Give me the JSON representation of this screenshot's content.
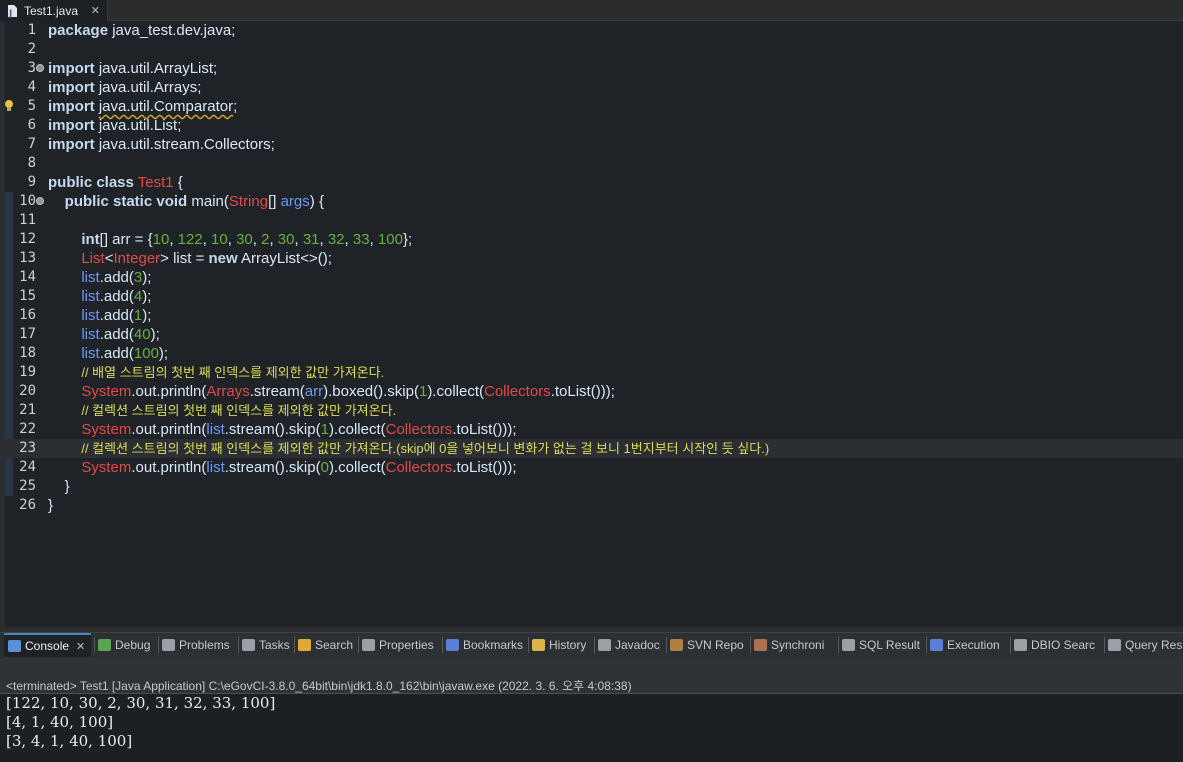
{
  "editor_tab": {
    "title": "Test1.java",
    "icon": "java-file-icon",
    "close_icon": "close-icon"
  },
  "colors": {
    "keyword": "#cc6c1d",
    "type": "#e04b49",
    "field": "#6b9bf4",
    "number": "#6aaf40",
    "comment": "#dddd55",
    "text": "#d9e8f7",
    "editor_bg": "#1f2327"
  },
  "code_lines": [
    {
      "n": "1",
      "tokens": [
        {
          "t": "package",
          "c": "kw2"
        },
        {
          "t": " java_test.dev.java;",
          "c": "plain"
        }
      ]
    },
    {
      "n": "2",
      "tokens": []
    },
    {
      "n": "3",
      "fold": true,
      "tokens": [
        {
          "t": "import",
          "c": "kw2"
        },
        {
          "t": " java.util.ArrayList;",
          "c": "plain"
        }
      ]
    },
    {
      "n": "4",
      "tokens": [
        {
          "t": "import",
          "c": "kw2"
        },
        {
          "t": " java.util.Arrays;",
          "c": "plain"
        }
      ]
    },
    {
      "n": "5",
      "bulb": true,
      "tokens": [
        {
          "t": "import",
          "c": "kw2"
        },
        {
          "t": " ",
          "c": "plain"
        },
        {
          "t": "java.util.Comparator",
          "c": "plain warn"
        },
        {
          "t": ";",
          "c": "plain"
        }
      ]
    },
    {
      "n": "6",
      "tokens": [
        {
          "t": "import",
          "c": "kw2"
        },
        {
          "t": " java.util.List;",
          "c": "plain"
        }
      ]
    },
    {
      "n": "7",
      "tokens": [
        {
          "t": "import",
          "c": "kw2"
        },
        {
          "t": " java.util.stream.Collectors;",
          "c": "plain"
        }
      ]
    },
    {
      "n": "8",
      "tokens": []
    },
    {
      "n": "9",
      "tokens": [
        {
          "t": "public class",
          "c": "kw2"
        },
        {
          "t": " ",
          "c": "plain"
        },
        {
          "t": "Test1",
          "c": "ty"
        },
        {
          "t": " {",
          "c": "plain"
        }
      ]
    },
    {
      "n": "10",
      "fold": true,
      "tokens": [
        {
          "t": "    ",
          "c": "plain"
        },
        {
          "t": "public static void",
          "c": "kw2"
        },
        {
          "t": " main(",
          "c": "plain"
        },
        {
          "t": "String",
          "c": "ty"
        },
        {
          "t": "[] ",
          "c": "plain"
        },
        {
          "t": "args",
          "c": "fld"
        },
        {
          "t": ") {",
          "c": "plain"
        }
      ]
    },
    {
      "n": "11",
      "tokens": []
    },
    {
      "n": "12",
      "tokens": [
        {
          "t": "        ",
          "c": "plain"
        },
        {
          "t": "int",
          "c": "kw2"
        },
        {
          "t": "[] arr = {",
          "c": "plain"
        },
        {
          "t": "10",
          "c": "num"
        },
        {
          "t": ", ",
          "c": "plain"
        },
        {
          "t": "122",
          "c": "num"
        },
        {
          "t": ", ",
          "c": "plain"
        },
        {
          "t": "10",
          "c": "num"
        },
        {
          "t": ", ",
          "c": "plain"
        },
        {
          "t": "30",
          "c": "num"
        },
        {
          "t": ", ",
          "c": "plain"
        },
        {
          "t": "2",
          "c": "num"
        },
        {
          "t": ", ",
          "c": "plain"
        },
        {
          "t": "30",
          "c": "num"
        },
        {
          "t": ", ",
          "c": "plain"
        },
        {
          "t": "31",
          "c": "num"
        },
        {
          "t": ", ",
          "c": "plain"
        },
        {
          "t": "32",
          "c": "num"
        },
        {
          "t": ", ",
          "c": "plain"
        },
        {
          "t": "33",
          "c": "num"
        },
        {
          "t": ", ",
          "c": "plain"
        },
        {
          "t": "100",
          "c": "num"
        },
        {
          "t": "};",
          "c": "plain"
        }
      ]
    },
    {
      "n": "13",
      "tokens": [
        {
          "t": "        ",
          "c": "plain"
        },
        {
          "t": "List",
          "c": "ty"
        },
        {
          "t": "<",
          "c": "plain"
        },
        {
          "t": "Integer",
          "c": "ty"
        },
        {
          "t": "> list = ",
          "c": "plain"
        },
        {
          "t": "new",
          "c": "kw2"
        },
        {
          "t": " ArrayList<>();",
          "c": "plain"
        }
      ]
    },
    {
      "n": "14",
      "tokens": [
        {
          "t": "        ",
          "c": "plain"
        },
        {
          "t": "list",
          "c": "fld"
        },
        {
          "t": ".add(",
          "c": "plain"
        },
        {
          "t": "3",
          "c": "num"
        },
        {
          "t": ");",
          "c": "plain"
        }
      ]
    },
    {
      "n": "15",
      "tokens": [
        {
          "t": "        ",
          "c": "plain"
        },
        {
          "t": "list",
          "c": "fld"
        },
        {
          "t": ".add(",
          "c": "plain"
        },
        {
          "t": "4",
          "c": "num"
        },
        {
          "t": ");",
          "c": "plain"
        }
      ]
    },
    {
      "n": "16",
      "tokens": [
        {
          "t": "        ",
          "c": "plain"
        },
        {
          "t": "list",
          "c": "fld"
        },
        {
          "t": ".add(",
          "c": "plain"
        },
        {
          "t": "1",
          "c": "num"
        },
        {
          "t": ");",
          "c": "plain"
        }
      ]
    },
    {
      "n": "17",
      "tokens": [
        {
          "t": "        ",
          "c": "plain"
        },
        {
          "t": "list",
          "c": "fld"
        },
        {
          "t": ".add(",
          "c": "plain"
        },
        {
          "t": "40",
          "c": "num"
        },
        {
          "t": ");",
          "c": "plain"
        }
      ]
    },
    {
      "n": "18",
      "tokens": [
        {
          "t": "        ",
          "c": "plain"
        },
        {
          "t": "list",
          "c": "fld"
        },
        {
          "t": ".add(",
          "c": "plain"
        },
        {
          "t": "100",
          "c": "num"
        },
        {
          "t": ");",
          "c": "plain"
        }
      ]
    },
    {
      "n": "19",
      "tokens": [
        {
          "t": "        ",
          "c": "plain"
        },
        {
          "t": "// 배열 스트림의 첫번 째 인덱스를 제외한 값만 가져온다.",
          "c": "cm"
        }
      ]
    },
    {
      "n": "20",
      "tokens": [
        {
          "t": "        ",
          "c": "plain"
        },
        {
          "t": "System",
          "c": "ty"
        },
        {
          "t": ".out.println(",
          "c": "plain"
        },
        {
          "t": "Arrays",
          "c": "ty"
        },
        {
          "t": ".stream(",
          "c": "plain"
        },
        {
          "t": "arr",
          "c": "fld"
        },
        {
          "t": ").boxed().skip(",
          "c": "plain"
        },
        {
          "t": "1",
          "c": "num"
        },
        {
          "t": ").collect(",
          "c": "plain"
        },
        {
          "t": "Collectors",
          "c": "ty"
        },
        {
          "t": ".toList()));",
          "c": "plain"
        }
      ]
    },
    {
      "n": "21",
      "tokens": [
        {
          "t": "        ",
          "c": "plain"
        },
        {
          "t": "// 컬렉션 스트림의 첫번 째 인덱스를 제외한 값만 가져온다.",
          "c": "cm"
        }
      ]
    },
    {
      "n": "22",
      "tokens": [
        {
          "t": "        ",
          "c": "plain"
        },
        {
          "t": "System",
          "c": "ty"
        },
        {
          "t": ".out.println(",
          "c": "plain"
        },
        {
          "t": "list",
          "c": "fld"
        },
        {
          "t": ".stream().skip(",
          "c": "plain"
        },
        {
          "t": "1",
          "c": "num"
        },
        {
          "t": ").collect(",
          "c": "plain"
        },
        {
          "t": "Collectors",
          "c": "ty"
        },
        {
          "t": ".toList()));",
          "c": "plain"
        }
      ]
    },
    {
      "n": "23",
      "current": true,
      "tokens": [
        {
          "t": "        ",
          "c": "plain"
        },
        {
          "t": "// 컬렉션 스트림의 첫번 째 인덱스를 제외한 값만 가져온다.(skip에 0을 넣어보니 변화가 없는 걸 보니 1번지부터 시작인 듯 싶다.)",
          "c": "cm"
        }
      ]
    },
    {
      "n": "24",
      "tokens": [
        {
          "t": "        ",
          "c": "plain"
        },
        {
          "t": "System",
          "c": "ty"
        },
        {
          "t": ".out.println(",
          "c": "plain"
        },
        {
          "t": "list",
          "c": "fld"
        },
        {
          "t": ".stream().skip(",
          "c": "plain"
        },
        {
          "t": "0",
          "c": "num"
        },
        {
          "t": ").collect(",
          "c": "plain"
        },
        {
          "t": "Collectors",
          "c": "ty"
        },
        {
          "t": ".toList()));",
          "c": "plain"
        }
      ]
    },
    {
      "n": "25",
      "tokens": [
        {
          "t": "    }",
          "c": "plain"
        }
      ]
    },
    {
      "n": "26",
      "tokens": [
        {
          "t": "}",
          "c": "plain"
        }
      ]
    }
  ],
  "panel_tabs": [
    {
      "label": "Console",
      "icon": "console-icon",
      "icon_color": "#5b8fd6",
      "active": true
    },
    {
      "label": "Debug",
      "icon": "bug-icon",
      "icon_color": "#5aa550"
    },
    {
      "label": "Problems",
      "icon": "problems-icon",
      "icon_color": "#9aa0a6"
    },
    {
      "label": "Tasks",
      "icon": "tasks-icon",
      "icon_color": "#9aa0a6"
    },
    {
      "label": "Search",
      "icon": "search-icon",
      "icon_color": "#e0a83a"
    },
    {
      "label": "Properties",
      "icon": "properties-icon",
      "icon_color": "#9aa0a6"
    },
    {
      "label": "Bookmarks",
      "icon": "bookmark-icon",
      "icon_color": "#5b7fd6"
    },
    {
      "label": "History",
      "icon": "history-icon",
      "icon_color": "#d8b44a"
    },
    {
      "label": "Javadoc",
      "icon": "javadoc-icon",
      "icon_color": "#9aa0a6"
    },
    {
      "label": "SVN Repo",
      "icon": "svn-icon",
      "icon_color": "#b08040"
    },
    {
      "label": "Synchroni",
      "icon": "synchronize-icon",
      "icon_color": "#b07050"
    },
    {
      "label": "SQL Result",
      "icon": "sql-result-icon",
      "icon_color": "#9aa0a6"
    },
    {
      "label": "Execution",
      "icon": "execution-icon",
      "icon_color": "#5b7fd6"
    },
    {
      "label": "DBIO Searc",
      "icon": "dbio-search-icon",
      "icon_color": "#9aa0a6"
    },
    {
      "label": "Query Resu",
      "icon": "query-result-icon",
      "icon_color": "#9aa0a6"
    }
  ],
  "console": {
    "status": "<terminated> Test1 [Java Application] C:\\eGovCI-3.8.0_64bit\\bin\\jdk1.8.0_162\\bin\\javaw.exe (2022. 3. 6. 오후 4:08:38)",
    "output": [
      "[122, 10, 30, 2, 30, 31, 32, 33, 100]",
      "[4, 1, 40, 100]",
      "[3, 4, 1, 40, 100]"
    ]
  }
}
